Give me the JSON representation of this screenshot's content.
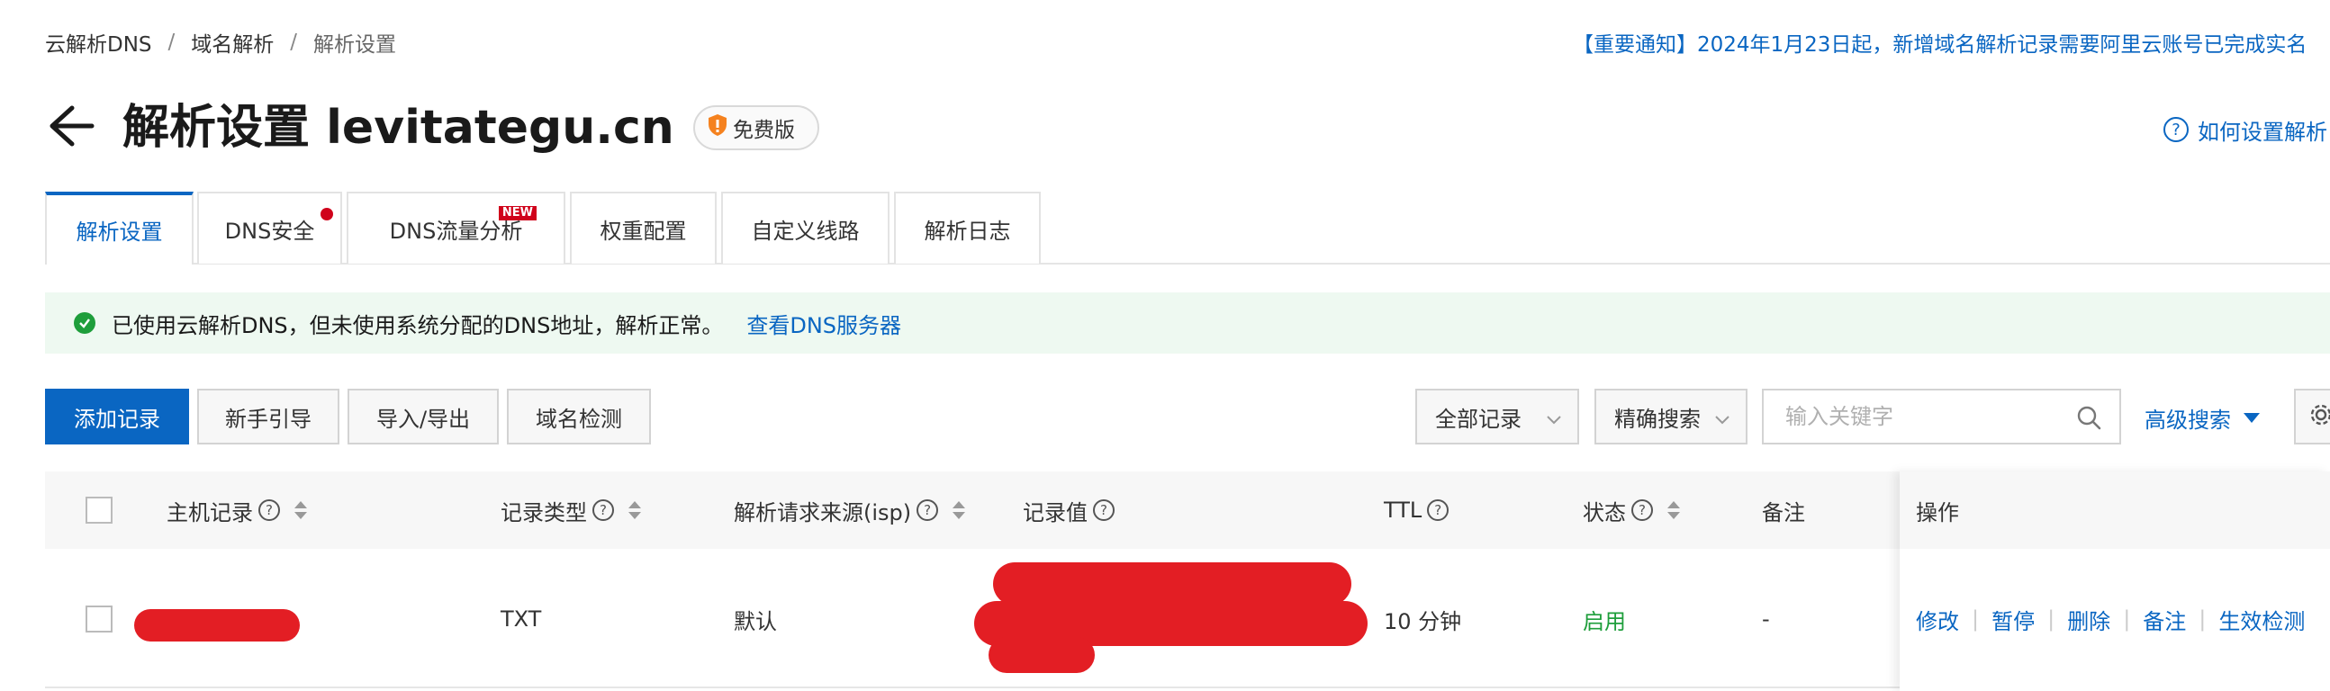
{
  "breadcrumb": {
    "items": [
      "云解析DNS",
      "域名解析",
      "解析设置"
    ],
    "separator": "/"
  },
  "notice": "【重要通知】2024年1月23日起，新增域名解析记录需要阿里云账号已完成实名",
  "header": {
    "title": "解析设置 levitategu.cn",
    "badge": "免费版",
    "help_link": "如何设置解析"
  },
  "tabs": [
    {
      "label": "解析设置",
      "active": true
    },
    {
      "label": "DNS安全",
      "dot": true
    },
    {
      "label": "DNS流量分析",
      "tag": "NEW"
    },
    {
      "label": "权重配置"
    },
    {
      "label": "自定义线路"
    },
    {
      "label": "解析日志"
    }
  ],
  "alert": {
    "text": "已使用云解析DNS，但未使用系统分配的DNS地址，解析正常。",
    "link": "查看DNS服务器"
  },
  "toolbar": {
    "add_record": "添加记录",
    "guide": "新手引导",
    "import_export": "导入/导出",
    "domain_check": "域名检测",
    "record_filter": "全部记录",
    "search_mode": "精确搜索",
    "search_placeholder": "输入关键字",
    "advanced_search": "高级搜索"
  },
  "table": {
    "columns": {
      "host": "主机记录",
      "type": "记录类型",
      "isp": "解析请求来源(isp)",
      "value": "记录值",
      "ttl": "TTL",
      "status": "状态",
      "remark": "备注",
      "ops": "操作"
    },
    "rows": [
      {
        "type": "TXT",
        "isp": "默认",
        "ttl": "10 分钟",
        "status": "启用",
        "remark": "-",
        "ops": [
          "修改",
          "暂停",
          "删除",
          "备注",
          "生效检测"
        ]
      }
    ]
  },
  "colors": {
    "accent": "#0a66c2",
    "success": "#1e9e3b",
    "danger": "#d0021b",
    "redaction": "#e31e24"
  }
}
